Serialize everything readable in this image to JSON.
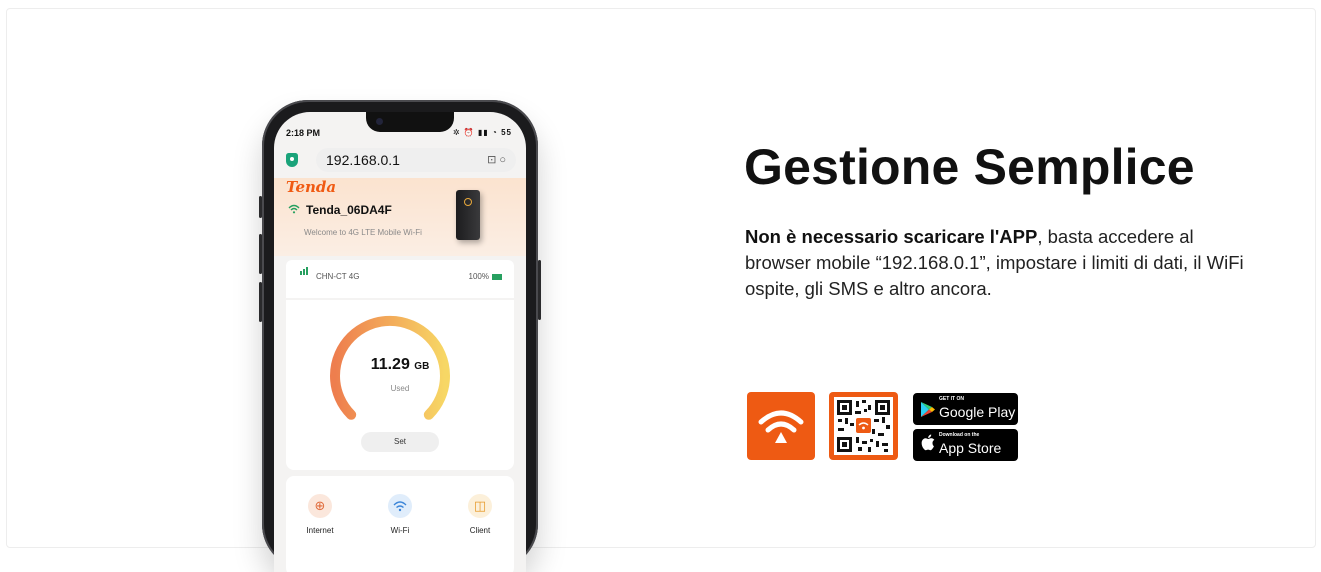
{
  "phone": {
    "status_time": "2:18 PM",
    "status_icons": "✲ ⏰ ▮▮ ◔ 55",
    "url": "192.168.0.1",
    "brand": "Tenda",
    "ssid": "Tenda_06DA4F",
    "welcome": "Welcome to 4G LTE Mobile Wi-Fi",
    "carrier": "CHN-CT  4G",
    "battery": "100%",
    "usage_value": "11.29",
    "usage_unit": "GB",
    "usage_label": "Used",
    "set_label": "Set",
    "menu": [
      {
        "label": "Internet",
        "icon": "globe-icon"
      },
      {
        "label": "Wi-Fi",
        "icon": "wifi-icon"
      },
      {
        "label": "Client",
        "icon": "devices-icon"
      }
    ],
    "colors": {
      "accent": "#f05a12",
      "gauge_start": "#ee7e4e",
      "gauge_end": "#f7d765",
      "signal": "#27a060"
    }
  },
  "content": {
    "headline": "Gestione Semplice",
    "desc_bold": "Non è necessario scaricare l'APP",
    "desc_rest": ", basta accedere al browser mobile “192.168.0.1”, impostare i limiti di dati, il WiFi ospite, gli SMS e altro ancora."
  },
  "downloads": {
    "google_small": "GET IT ON",
    "google_big": "Google Play",
    "apple_small": "Download on the",
    "apple_big": "App Store",
    "brand_color": "#ee5a13"
  }
}
